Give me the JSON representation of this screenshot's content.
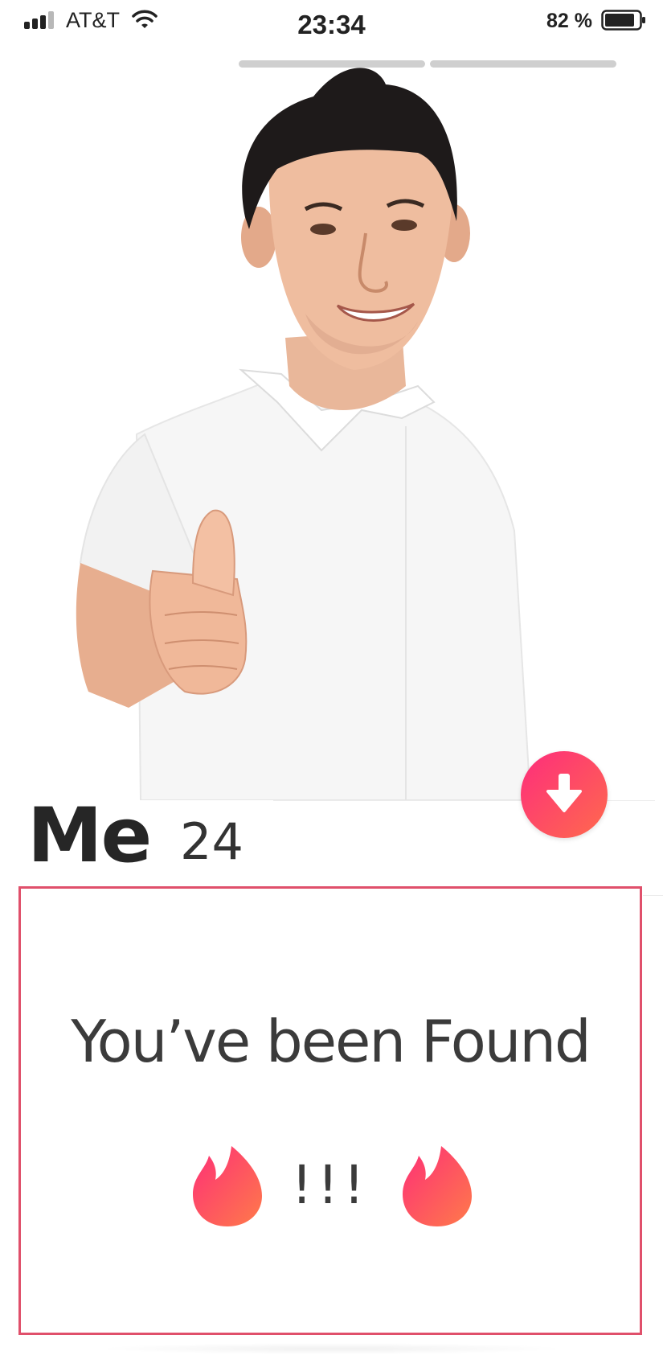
{
  "status_bar": {
    "carrier": "AT&T",
    "time": "23:34",
    "battery_percent": "82 %",
    "icons": [
      "cellular-signal-icon",
      "wifi-icon",
      "battery-icon"
    ]
  },
  "photo": {
    "total_photos": 2,
    "current_photo": 1,
    "description_icon": "profile-photo"
  },
  "profile": {
    "name": "Me",
    "age": "24"
  },
  "card": {
    "message": "You’ve been Found",
    "exclamation": "!!!",
    "decor_icon": "flame-icon"
  },
  "actions": {
    "collapse_button_icon": "arrow-down-icon"
  },
  "colors": {
    "accent_start": "#fd2d7c",
    "accent_end": "#ff6a4d",
    "card_border": "#e0506b"
  }
}
